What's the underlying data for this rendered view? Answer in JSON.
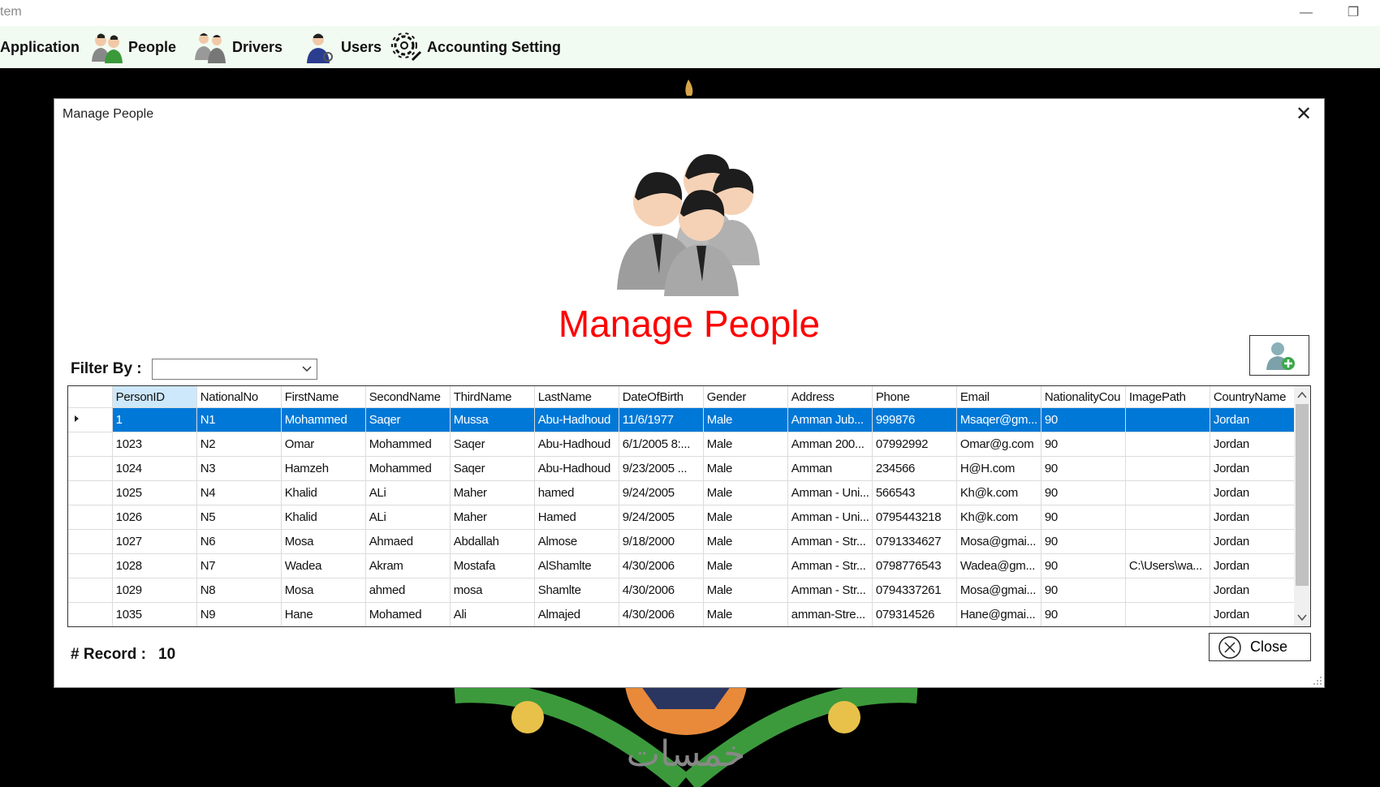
{
  "window": {
    "title": "tem"
  },
  "menu": {
    "items": [
      {
        "label": "Application"
      },
      {
        "label": "People"
      },
      {
        "label": "Drivers"
      },
      {
        "label": "Users"
      },
      {
        "label": "Accounting Setting"
      }
    ]
  },
  "dialog": {
    "title": "Manage People",
    "heading": "Manage People",
    "filter_label": "Filter By :",
    "filter_value": "",
    "record_label": "# Record :",
    "record_count": "10",
    "close_label": "Close"
  },
  "wallpaper": {
    "text": "خمسات"
  },
  "grid": {
    "columns": [
      "PersonID",
      "NationalNo",
      "FirstName",
      "SecondName",
      "ThirdName",
      "LastName",
      "DateOfBirth",
      "Gender",
      "Address",
      "Phone",
      "Email",
      "NationalityCou",
      "ImagePath",
      "CountryName"
    ],
    "rows": [
      [
        "1",
        "N1",
        "Mohammed",
        "Saqer",
        "Mussa",
        "Abu-Hadhoud",
        "11/6/1977",
        "Male",
        "Amman Jub...",
        "999876",
        "Msaqer@gm...",
        "90",
        "",
        "Jordan"
      ],
      [
        "1023",
        "N2",
        "Omar",
        "Mohammed",
        "Saqer",
        "Abu-Hadhoud",
        "6/1/2005 8:...",
        "Male",
        "Amman 200...",
        "07992992",
        "Omar@g.com",
        "90",
        "",
        "Jordan"
      ],
      [
        "1024",
        "N3",
        "Hamzeh",
        "Mohammed",
        "Saqer",
        "Abu-Hadhoud",
        "9/23/2005 ...",
        "Male",
        "Amman",
        "234566",
        "H@H.com",
        "90",
        "",
        "Jordan"
      ],
      [
        "1025",
        "N4",
        "Khalid",
        "ALi",
        "Maher",
        "hamed",
        "9/24/2005",
        "Male",
        "Amman - Uni...",
        "566543",
        "Kh@k.com",
        "90",
        "",
        "Jordan"
      ],
      [
        "1026",
        "N5",
        "Khalid",
        "ALi",
        "Maher",
        "Hamed",
        "9/24/2005",
        "Male",
        "Amman - Uni...",
        "0795443218",
        "Kh@k.com",
        "90",
        "",
        "Jordan"
      ],
      [
        "1027",
        "N6",
        "Mosa",
        "Ahmaed",
        "Abdallah",
        "Almose",
        "9/18/2000",
        "Male",
        "Amman - Str...",
        "0791334627",
        "Mosa@gmai...",
        "90",
        "",
        "Jordan"
      ],
      [
        "1028",
        "N7",
        "Wadea",
        "Akram",
        "Mostafa",
        "AlShamlte",
        "4/30/2006",
        "Male",
        "Amman - Str...",
        "0798776543",
        "Wadea@gm...",
        "90",
        "C:\\Users\\wa...",
        "Jordan"
      ],
      [
        "1029",
        "N8",
        "Mosa",
        "ahmed",
        "mosa",
        "Shamlte",
        "4/30/2006",
        "Male",
        "Amman - Str...",
        "0794337261",
        "Mosa@gmai...",
        "90",
        "",
        "Jordan"
      ],
      [
        "1035",
        "N9",
        "Hane",
        "Mohamed",
        "Ali",
        "Almajed",
        "4/30/2006",
        "Male",
        "amman-Stre...",
        "079314526",
        "Hane@gmai...",
        "90",
        "",
        "Jordan"
      ]
    ]
  },
  "colors": {
    "accent": "#0078d7",
    "title_red": "#ff0000",
    "menubar": "#f2fbf1"
  }
}
